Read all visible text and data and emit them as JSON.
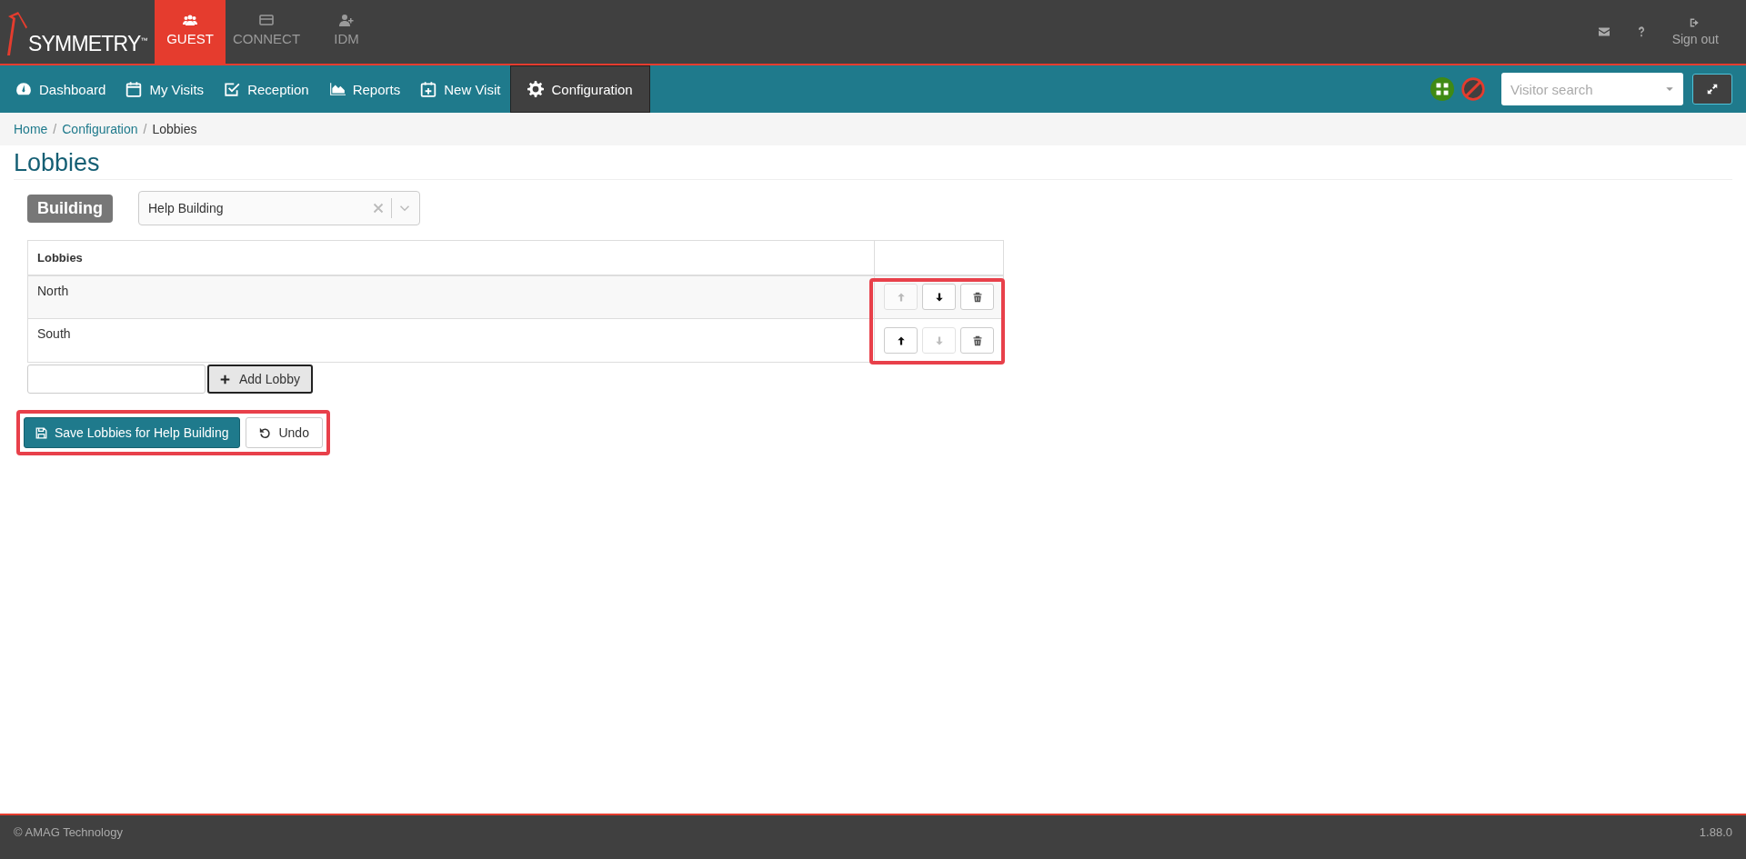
{
  "logo": {
    "text": "SYMMETRY$^{™}$"
  },
  "apps": [
    {
      "label": "GUEST",
      "selected": true
    },
    {
      "label": "CONNECT",
      "selected": false
    },
    {
      "label": "IDM",
      "selected": false
    }
  ],
  "top_right": {
    "sign_out": "Sign out"
  },
  "nav": [
    {
      "label": "Dashboard",
      "selected": false
    },
    {
      "label": "My Visits",
      "selected": false
    },
    {
      "label": "Reception",
      "selected": false
    },
    {
      "label": "Reports",
      "selected": false
    },
    {
      "label": "New Visit",
      "selected": false
    },
    {
      "label": "Configuration",
      "selected": true
    }
  ],
  "visitor_search": {
    "placeholder": "Visitor search"
  },
  "breadcrumb": [
    {
      "label": "Home",
      "current": false
    },
    {
      "label": "Configuration",
      "separator": "/",
      "current": false
    },
    {
      "label": "Lobbies",
      "separator": "/",
      "current": true
    }
  ],
  "page_title": "Lobbies",
  "building": {
    "label": "Building",
    "value": "Help Building"
  },
  "table": {
    "columns": [
      "Lobbies"
    ],
    "rows": [
      {
        "name": "North",
        "up_disabled": true,
        "down_disabled": false
      },
      {
        "name": "South",
        "up_disabled": false,
        "down_disabled": true
      }
    ]
  },
  "add_lobby": {
    "button": "Add Lobby"
  },
  "actions": {
    "save": "Save Lobbies for Help Building",
    "undo": "Undo"
  },
  "footer": {
    "copyright": "© AMAG Technology",
    "version": "1.88.0"
  }
}
